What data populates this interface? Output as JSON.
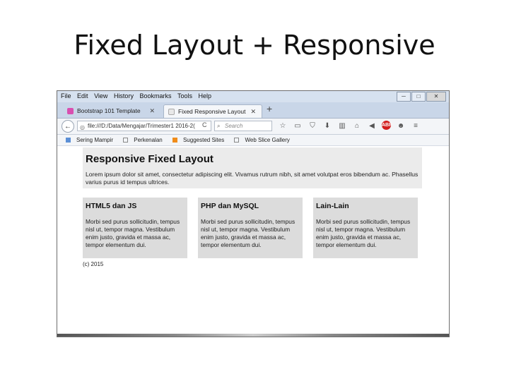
{
  "slide": {
    "title": "Fixed Layout + Responsive"
  },
  "menubar": {
    "items": [
      "File",
      "Edit",
      "View",
      "History",
      "Bookmarks",
      "Tools",
      "Help"
    ]
  },
  "window_controls": {
    "minimize": "─",
    "maximize": "□",
    "close": "✕"
  },
  "tabs": [
    {
      "label": "Bootstrap 101 Template",
      "close": "✕"
    },
    {
      "label": "Fixed Responsive Layout",
      "close": "✕"
    }
  ],
  "new_tab": "+",
  "navbar": {
    "back": "←",
    "url": "file:///D:/Data/Mengajar/Trimester1 2016-2(",
    "reload": "C",
    "search_placeholder": "Search",
    "tool_icons": [
      "star-icon",
      "clipboard-icon",
      "shield-icon",
      "download-icon",
      "library-icon",
      "home-icon",
      "send-icon",
      "adblock-icon",
      "chat-icon",
      "menu-icon"
    ]
  },
  "bookmarks": {
    "items": [
      "Sering Mampir",
      "Perkenalan",
      "Suggested Sites",
      "Web Slice Gallery"
    ]
  },
  "page": {
    "heading": "Responsive Fixed Layout",
    "intro": "Lorem ipsum dolor sit amet, consectetur adipiscing elit. Vivamus rutrum nibh, sit amet volutpat eros bibendum ac. Phasellus varius purus id tempus ultrices.",
    "columns": [
      {
        "title": "HTML5 dan JS",
        "text": "Morbi sed purus sollicitudin, tempus nisl ut, tempor magna. Vestibulum enim justo, gravida et massa ac, tempor elementum dui."
      },
      {
        "title": "PHP dan MySQL",
        "text": "Morbi sed purus sollicitudin, tempus nisl ut, tempor magna. Vestibulum enim justo, gravida et massa ac, tempor elementum dui."
      },
      {
        "title": "Lain-Lain",
        "text": "Morbi sed purus sollicitudin, tempus nisl ut, tempor magna. Vestibulum enim justo, gravida et massa ac, tempor elementum dui."
      }
    ],
    "footer": "(c) 2015"
  },
  "colors": {
    "hero_bg": "#ebebeb",
    "column_bg": "#dcdcdc",
    "menubar_bg": "#d6e1ef"
  }
}
